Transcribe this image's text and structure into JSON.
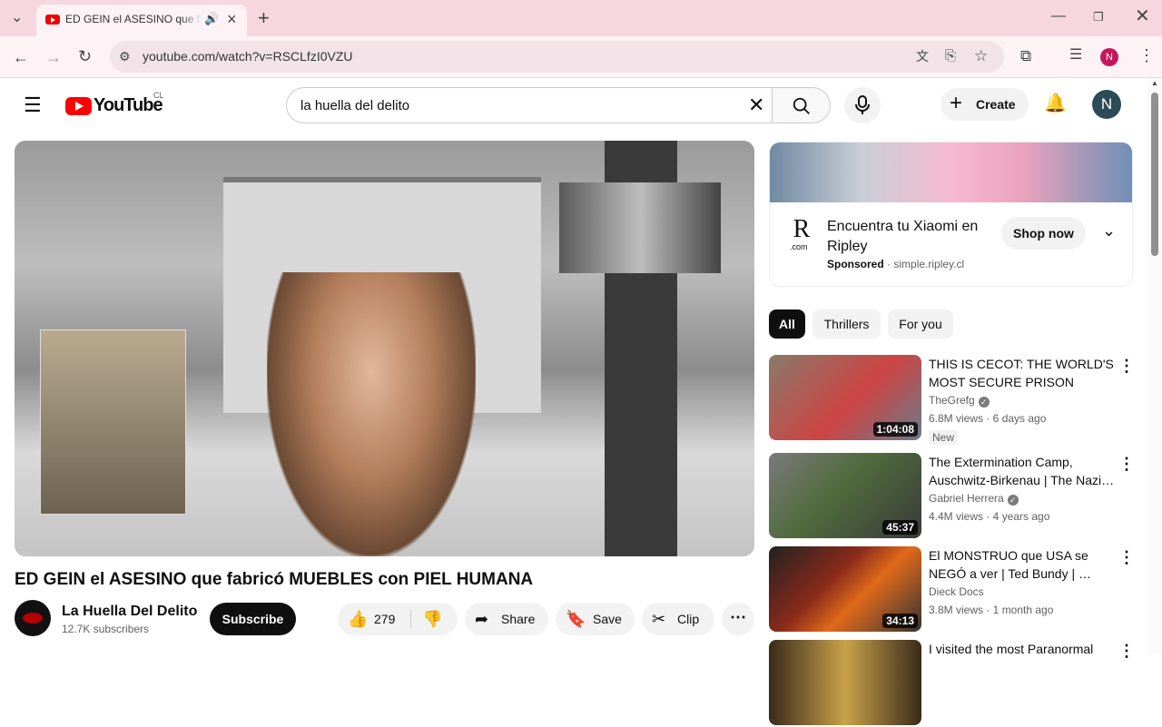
{
  "browser": {
    "tab_title": "ED GEIN el ASESINO que fabricó MUEBLES con PIEL HUMANA",
    "url": "youtube.com/watch?v=RSCLfzI0VZU",
    "profile_initial": "N",
    "close_icon": "×",
    "new_tab_icon": "+"
  },
  "youtube": {
    "logo_text": "YouTube",
    "region": "CL",
    "search_query": "la huella del delito",
    "create_label": "Create",
    "avatar_initial": "N"
  },
  "video": {
    "title": "ED GEIN el ASESINO que fabricó MUEBLES con PIEL HUMANA",
    "channel_name": "La Huella Del Delito",
    "subscribers": "12.7K subscribers",
    "subscribe_label": "Subscribe",
    "likes": "279",
    "share_label": "Share",
    "save_label": "Save",
    "clip_label": "Clip"
  },
  "ad": {
    "text": "Encuentra tu Xiaomi en Ripley",
    "sponsored": "Sponsored",
    "domain": "simple.ripley.cl",
    "cta": "Shop now",
    "logo_letter": "R",
    "logo_sub": ".com"
  },
  "chips": [
    "All",
    "Thrillers",
    "For you"
  ],
  "recommendations": [
    {
      "title": "THIS IS CECOT: THE WORLD'S MOST SECURE PRISON",
      "channel": "TheGrefg",
      "verified": true,
      "meta": "6.8M views · 6 days ago",
      "badge": "New",
      "duration": "1:04:08"
    },
    {
      "title": "The Extermination Camp, Auschwitz-Birkenau | The Nazi…",
      "channel": "Gabriel Herrera",
      "verified": true,
      "meta": "4.4M views · 4 years ago",
      "badge": "",
      "duration": "45:37"
    },
    {
      "title": "El MONSTRUO que USA se NEGÓ a ver | Ted Bundy | …",
      "channel": "Dieck Docs",
      "verified": false,
      "meta": "3.8M views · 1 month ago",
      "badge": "",
      "duration": "34:13"
    },
    {
      "title": "I visited the most Paranormal",
      "channel": "",
      "verified": false,
      "meta": "",
      "badge": "",
      "duration": ""
    }
  ]
}
